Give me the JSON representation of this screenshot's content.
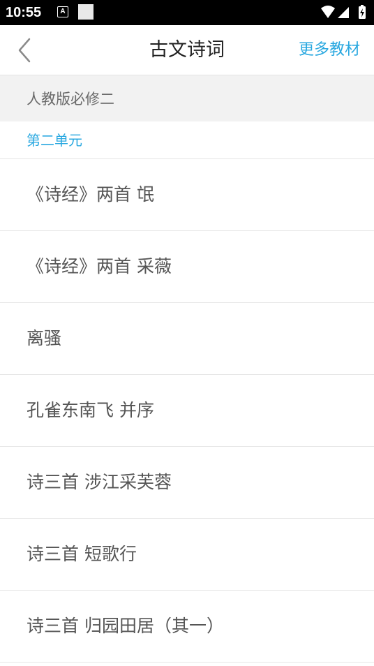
{
  "status_bar": {
    "time": "10:55",
    "notification_icon_letter": "A"
  },
  "header": {
    "title": "古文诗词",
    "more_label": "更多教材",
    "accent_color": "#29a8e0"
  },
  "section": {
    "title": "人教版必修二",
    "unit": "第二单元"
  },
  "poems": [
    {
      "label": "《诗经》两首 氓"
    },
    {
      "label": "《诗经》两首 采薇"
    },
    {
      "label": "离骚"
    },
    {
      "label": "孔雀东南飞 并序"
    },
    {
      "label": "诗三首 涉江采芙蓉"
    },
    {
      "label": "诗三首 短歌行"
    },
    {
      "label": "诗三首 归园田居（其一）"
    }
  ]
}
